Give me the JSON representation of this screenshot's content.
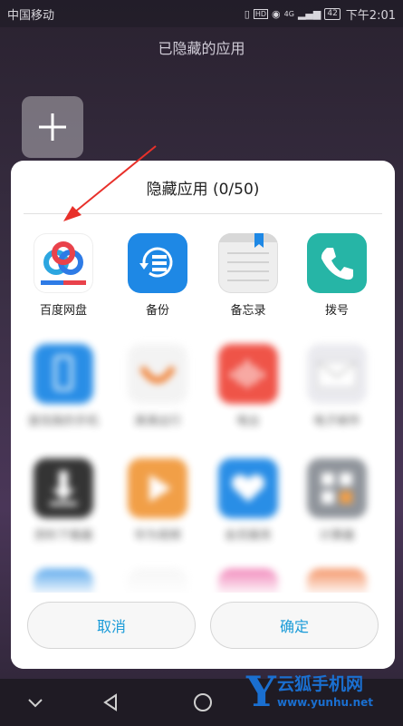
{
  "status_bar": {
    "carrier": "中国移动",
    "time": "下午2:01",
    "battery": "42",
    "network": "4G"
  },
  "background": {
    "title": "已隐藏的应用",
    "add_icon": "plus-icon"
  },
  "dialog": {
    "title": "隐藏应用 (0/50)",
    "apps": [
      {
        "label": "百度网盘",
        "icon": "baidu-netdisk-icon",
        "color": "#ffffff",
        "blurred": false
      },
      {
        "label": "备份",
        "icon": "backup-icon",
        "color": "#1e88e5",
        "blurred": false
      },
      {
        "label": "备忘录",
        "icon": "notepad-icon",
        "color": "#eeeeee",
        "blurred": false
      },
      {
        "label": "拨号",
        "icon": "phone-icon",
        "color": "#26b5a6",
        "blurred": false
      },
      {
        "label": "查找我的手机",
        "icon": "find-phone-icon",
        "color": "#1e88e5",
        "blurred": true
      },
      {
        "label": "滴滴出行",
        "icon": "didi-icon",
        "color": "#f3f3f3",
        "blurred": true
      },
      {
        "label": "电台",
        "icon": "radio-icon",
        "color": "#ef4b3f",
        "blurred": true
      },
      {
        "label": "电子邮件",
        "icon": "mail-icon",
        "color": "#e9e9ee",
        "blurred": true
      },
      {
        "label": "资料下载器",
        "icon": "download-icon",
        "color": "#2a2a2a",
        "blurred": true
      },
      {
        "label": "华为视频",
        "icon": "video-icon",
        "color": "#f19a3e",
        "blurred": true
      },
      {
        "label": "会员服务",
        "icon": "member-icon",
        "color": "#1e88e5",
        "blurred": true
      },
      {
        "label": "计算器",
        "icon": "calculator-icon",
        "color": "#8a8f96",
        "blurred": true
      }
    ],
    "cancel_label": "取消",
    "ok_label": "确定"
  },
  "watermark": {
    "letter": "Y",
    "name": "云狐手机网",
    "url": "www.yunhu.net"
  }
}
